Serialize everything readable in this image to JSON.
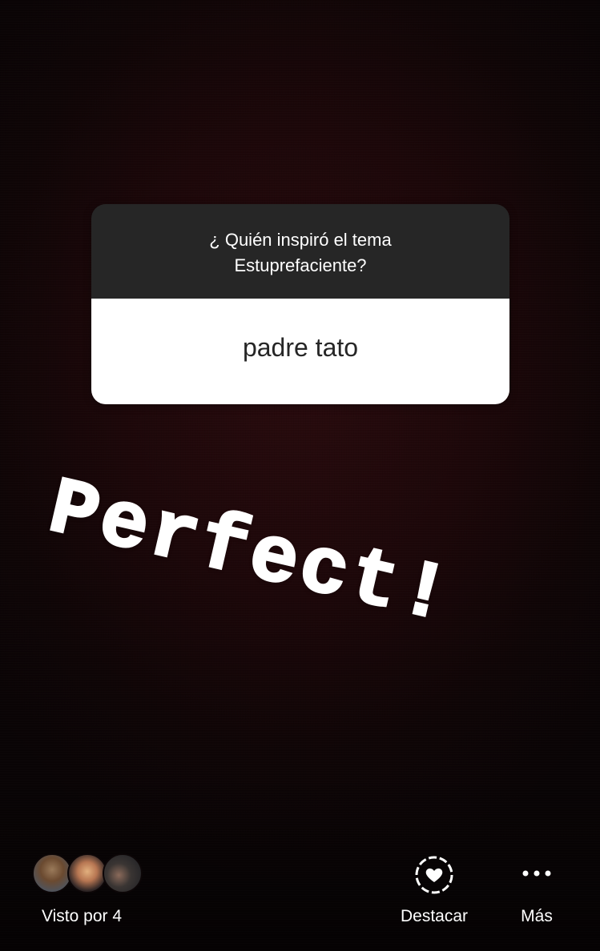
{
  "question_sticker": {
    "question": "¿ Quién inspiró el tema\nEstuprefaciente?",
    "answer": "padre tato"
  },
  "text_sticker": {
    "text": "Perfect!"
  },
  "footer": {
    "viewers_label": "Visto por 4",
    "highlight_label": "Destacar",
    "more_label": "Más",
    "icons": [
      "heart-circle-icon",
      "more-dots-icon"
    ]
  },
  "colors": {
    "background": "#1c0709",
    "card_header": "#262626",
    "card_body": "#ffffff",
    "text_primary": "#ffffff"
  }
}
